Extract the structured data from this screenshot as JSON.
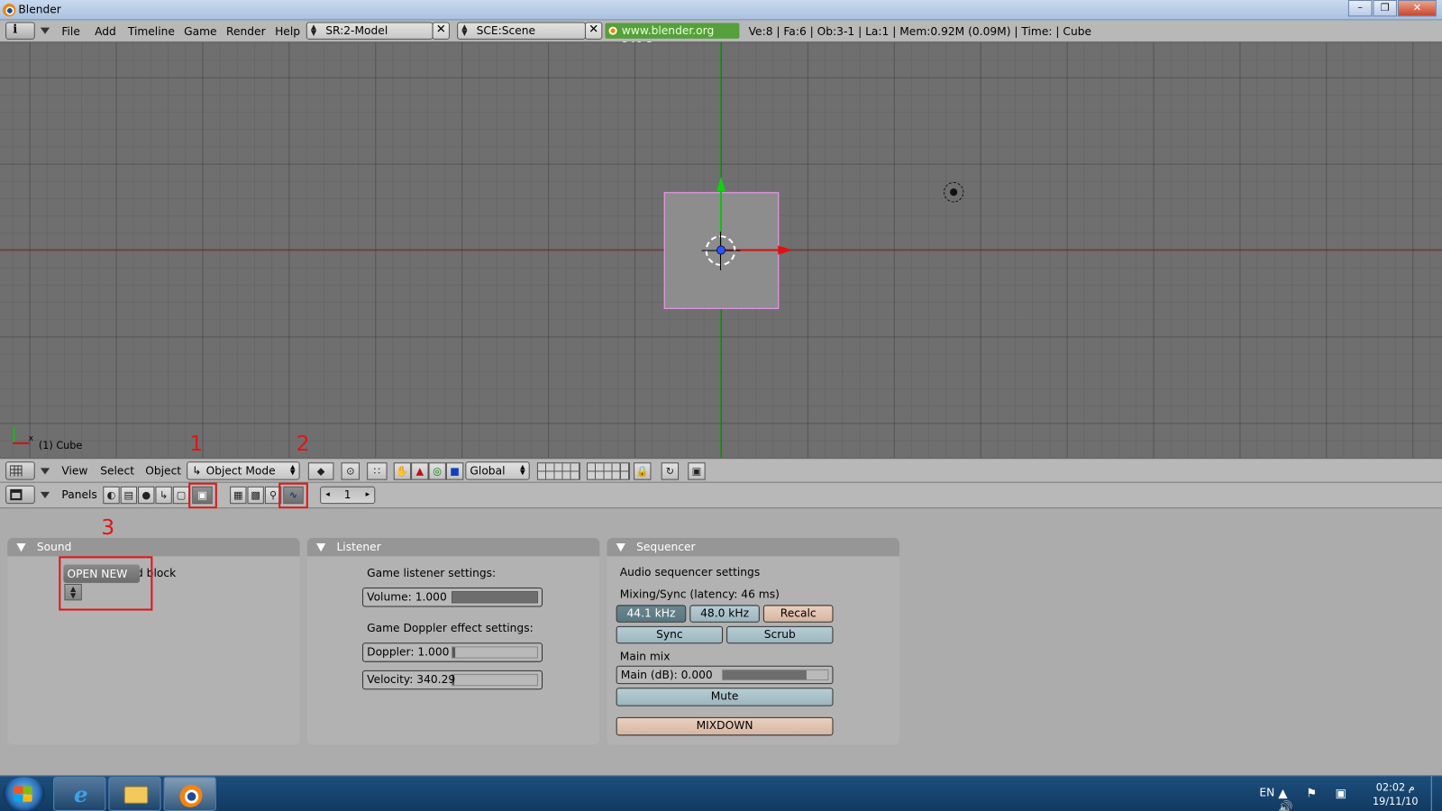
{
  "window": {
    "title": "Blender",
    "minimize_label": "–",
    "maximize_label": "❐",
    "close_label": "✕"
  },
  "info_header": {
    "menu": [
      "File",
      "Add",
      "Timeline",
      "Game",
      "Render",
      "Help"
    ],
    "screen_field": "SR:2-Model",
    "scene_field": "SCE:Scene",
    "url_badge": "www.blender.org 249.2",
    "stats": "Ve:8 | Fa:6 | Ob:3-1 | La:1  | Mem:0.92M (0.09M)  | Time: | Cube"
  },
  "viewport": {
    "object_label": "(1) Cube",
    "axis_label": "x"
  },
  "view_header": {
    "menu": [
      "View",
      "Select",
      "Object"
    ],
    "mode": "Object Mode",
    "orientation": "Global"
  },
  "buttons_header": {
    "panels_label": "Panels",
    "frame_number": "1"
  },
  "annotations": {
    "one": "1",
    "two": "2",
    "three": "3"
  },
  "sound_panel": {
    "title": "Sound",
    "datablock_text": "d block",
    "open_new_label": "OPEN NEW"
  },
  "listener_panel": {
    "title": "Listener",
    "game_listener_label": "Game listener settings:",
    "volume_label": "Volume: 1.000",
    "volume_fraction": 1.0,
    "doppler_heading": "Game Doppler effect settings:",
    "doppler_label": "Doppler: 1.000",
    "doppler_fraction": 0.02,
    "velocity_label": "Velocity: 340.29",
    "velocity_fraction": 0.01
  },
  "sequencer_panel": {
    "title": "Sequencer",
    "heading": "Audio sequencer settings",
    "mixing_label": "Mixing/Sync (latency: 46 ms)",
    "rate_44": "44.1 kHz",
    "rate_48": "48.0 kHz",
    "recalc": "Recalc",
    "sync": "Sync",
    "scrub": "Scrub",
    "main_mix_label": "Main mix",
    "main_db_label": "Main (dB): 0.000",
    "main_db_fraction": 0.8,
    "mute": "Mute",
    "mixdown": "MIXDOWN"
  },
  "taskbar": {
    "language": "EN",
    "time": "02:02 م",
    "date": "19/11/10",
    "tray_icons": "▲ ⚑ ▣ 🔊"
  },
  "colors": {
    "annotation_red": "#e01515",
    "cube_outline": "#f39af3",
    "url_badge_bg": "#55a03c"
  }
}
